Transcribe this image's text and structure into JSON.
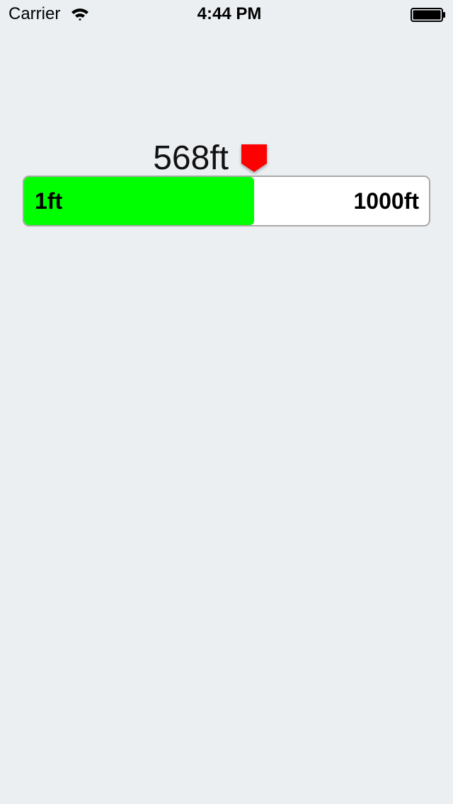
{
  "status_bar": {
    "carrier": "Carrier",
    "time": "4:44 PM",
    "icons": [
      "wifi-icon",
      "battery-icon"
    ]
  },
  "slider": {
    "value_label": "568ft",
    "min_label": "1ft",
    "max_label": "1000ft",
    "min": 1,
    "max": 1000,
    "value": 568,
    "fill_color": "#00ff00",
    "thumb_color": "#ff0000",
    "thumb_icon": "pin-marker-icon"
  }
}
